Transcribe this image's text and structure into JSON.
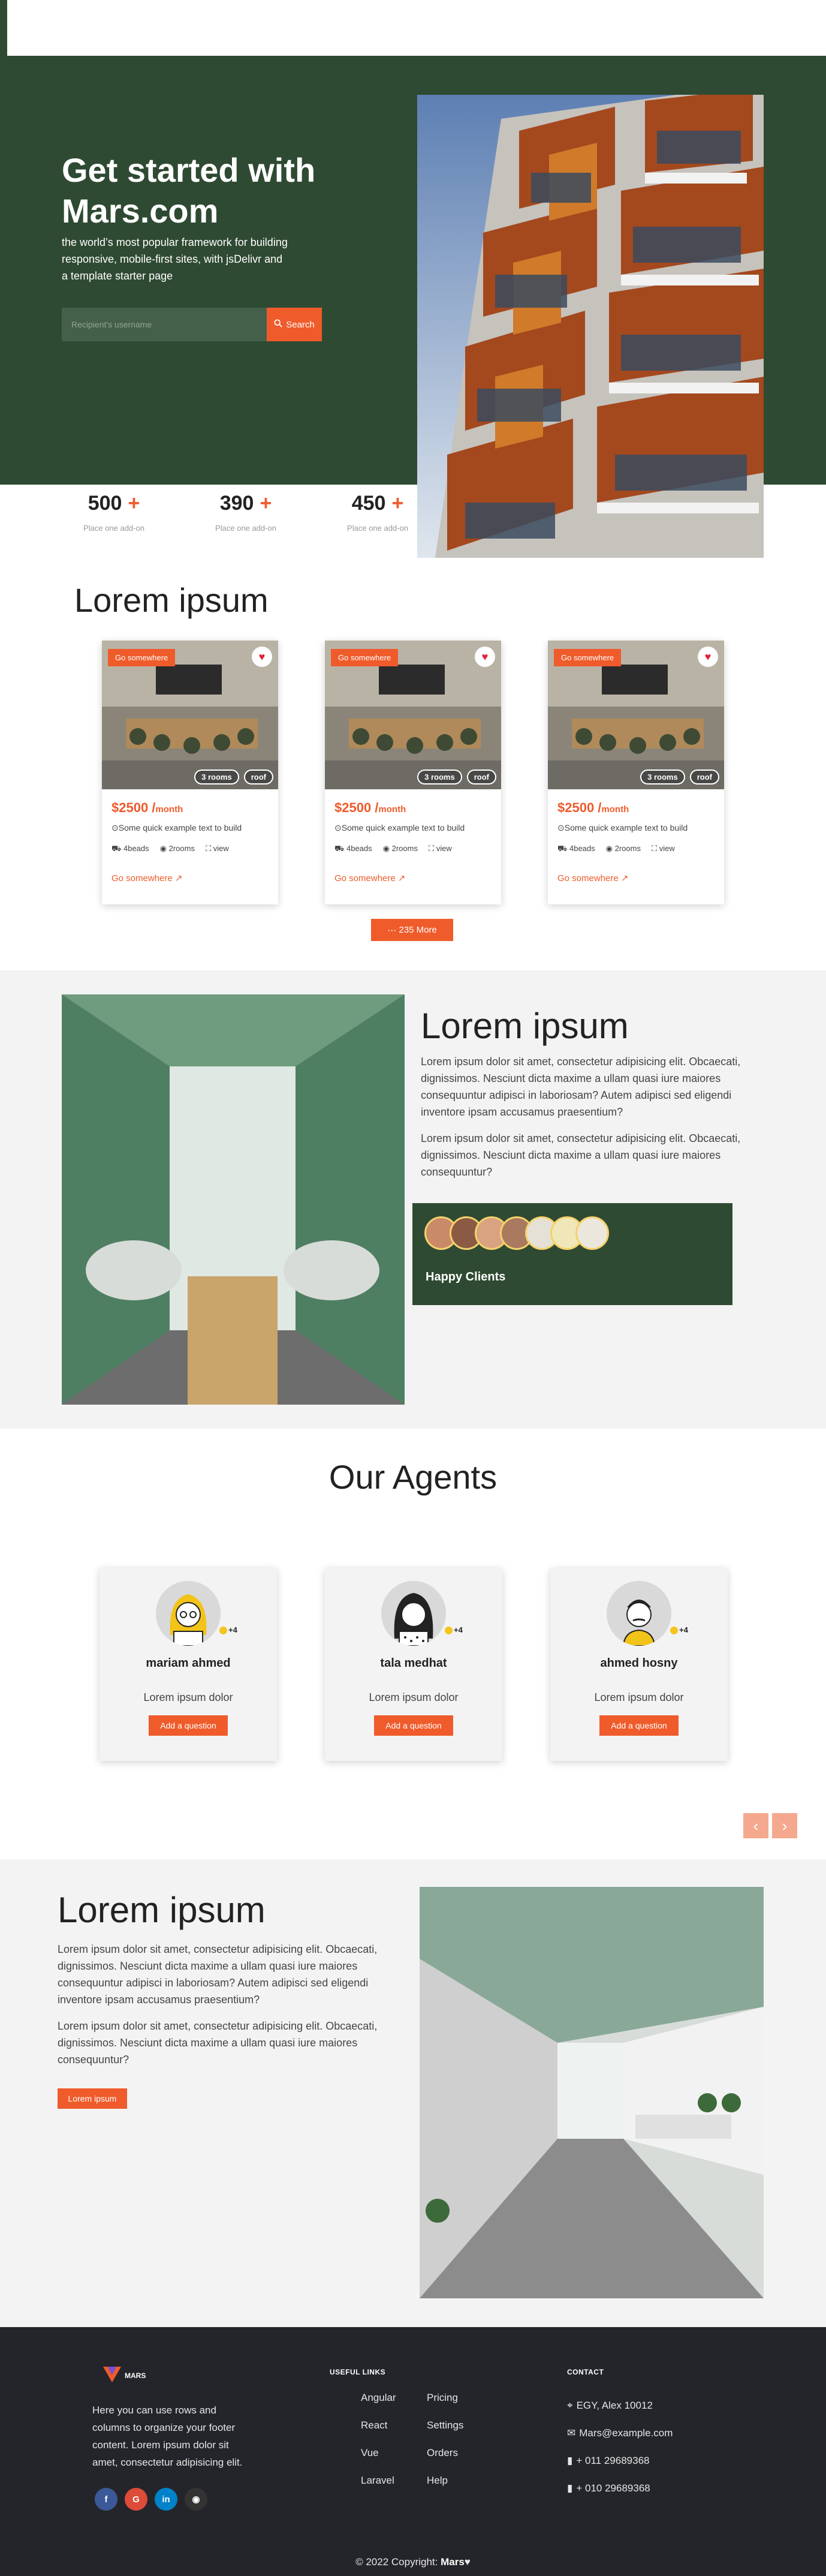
{
  "hero": {
    "title": "Get started with Mars.com",
    "subtitle": "the world’s most popular framework for building responsive, mobile-first sites, with jsDelivr and a template starter page",
    "search_placeholder": "Recipient's username",
    "search_label": "Search"
  },
  "stats": [
    {
      "value": "500",
      "plus": "+",
      "label": "Place one add-on"
    },
    {
      "value": "390",
      "plus": "+",
      "label": "Place one add-on"
    },
    {
      "value": "450",
      "plus": "+",
      "label": "Place one add-on"
    }
  ],
  "listings": {
    "title": "Lorem ipsum",
    "more_label": "235 More",
    "cards": [
      {
        "tag": "Go somewhere",
        "rooms": "3 rooms",
        "roof": "roof",
        "price": "$2500 /",
        "period": "month",
        "desc": "Some quick example text to build",
        "beds": "4beads",
        "baths": "2rooms",
        "view": "view",
        "link": "Go somewhere ↗"
      },
      {
        "tag": "Go somewhere",
        "rooms": "3 rooms",
        "roof": "roof",
        "price": "$2500 /",
        "period": "month",
        "desc": "Some quick example text to build",
        "beds": "4beads",
        "baths": "2rooms",
        "view": "view",
        "link": "Go somewhere ↗"
      },
      {
        "tag": "Go somewhere",
        "rooms": "3 rooms",
        "roof": "roof",
        "price": "$2500 /",
        "period": "month",
        "desc": "Some quick example text to build",
        "beds": "4beads",
        "baths": "2rooms",
        "view": "view",
        "link": "Go somewhere ↗"
      }
    ]
  },
  "about": {
    "title": "Lorem ipsum",
    "p1": "Lorem ipsum dolor sit amet, consectetur adipisicing elit. Obcaecati, dignissimos. Nesciunt dicta maxime a ullam quasi iure maiores consequuntur adipisci in laboriosam? Autem adipisci sed eligendi inventore ipsam accusamus praesentium?",
    "p2": "Lorem ipsum dolor sit amet, consectetur adipisicing elit. Obcaecati, dignissimos. Nesciunt dicta maxime a ullam quasi iure maiores consequuntur?",
    "clients_label": "Happy Clients"
  },
  "agents": {
    "title": "Our Agents",
    "items": [
      {
        "name": "mariam ahmed",
        "role": "Lorem ipsum dolor",
        "ask": "Add a question",
        "badge": "+4"
      },
      {
        "name": "tala medhat",
        "role": "Lorem ipsum dolor",
        "ask": "Add a question",
        "badge": "+4"
      },
      {
        "name": "ahmed hosny",
        "role": "Lorem ipsum dolor",
        "ask": "Add a question",
        "badge": "+4"
      }
    ],
    "prev": "‹",
    "next": "›"
  },
  "sec5": {
    "title": "Lorem ipsum",
    "p1": "Lorem ipsum dolor sit amet, consectetur adipisicing elit. Obcaecati, dignissimos. Nesciunt dicta maxime a ullam quasi iure maiores consequuntur adipisci in laboriosam? Autem adipisci sed eligendi inventore ipsam accusamus praesentium?",
    "p2": "Lorem ipsum dolor sit amet, consectetur adipisicing elit. Obcaecati, dignissimos. Nesciunt dicta maxime a ullam quasi iure maiores consequuntur?",
    "button": "Lorem ipsum"
  },
  "footer": {
    "logo": "MARS",
    "about": "Here you can use rows and columns to organize your footer content. Lorem ipsum dolor sit amet, consectetur adipisicing elit.",
    "useful_links_title": "USEFUL LINKS",
    "links_col1": [
      "Angular",
      "React",
      "Vue",
      "Laravel"
    ],
    "links_col2": [
      "Pricing",
      "Settings",
      "Orders",
      "Help"
    ],
    "contact_title": "CONTACT",
    "contact": [
      "EGY, Alex 10012",
      "Mars@example.com",
      "+ 011 29689368",
      "+ 010 29689368"
    ],
    "copyright": "© 2022 Copyright:",
    "brand": "Mars"
  },
  "colors": {
    "accent": "#ef5b2b",
    "green": "#2f4a32",
    "footer": "#24252a"
  }
}
